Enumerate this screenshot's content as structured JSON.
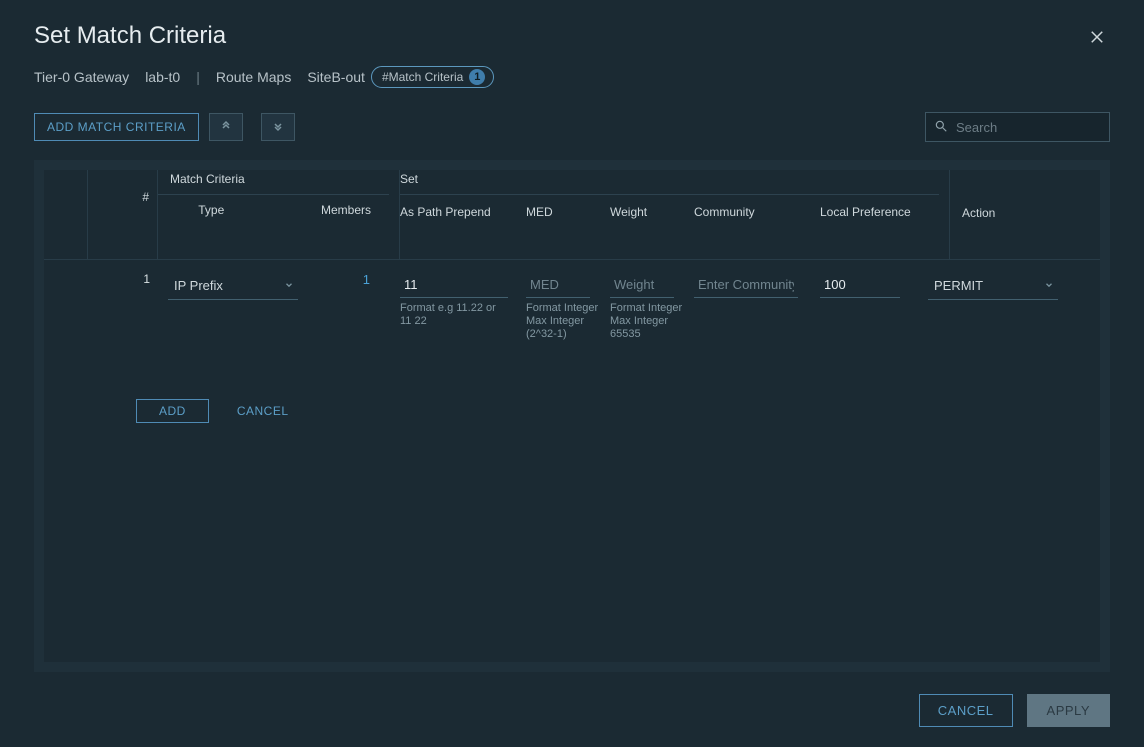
{
  "header": {
    "title": "Set Match Criteria"
  },
  "breadcrumb": {
    "segment1": "Tier-0 Gateway",
    "segment2": "lab-t0",
    "segment3": "Route Maps",
    "segment4": "SiteB-out",
    "chip_label": "#Match Criteria",
    "chip_count": "1"
  },
  "toolbar": {
    "add_button_label": "ADD MATCH CRITERIA",
    "search_placeholder": "Search"
  },
  "table": {
    "columns": {
      "index": "#",
      "match_criteria": "Match Criteria",
      "type": "Type",
      "members": "Members",
      "set": "Set",
      "as_path_prepend": "As Path Prepend",
      "med": "MED",
      "weight": "Weight",
      "community": "Community",
      "local_preference": "Local Preference",
      "action": "Action"
    },
    "row": {
      "index": "1",
      "type_selected": "IP Prefix",
      "members": "1",
      "as_path_prepend_value": "11",
      "as_path_prepend_hint": "Format e.g 11.22 or 11 22",
      "med_placeholder": "MED",
      "med_hint": "Format Integer Max Integer (2^32-1)",
      "weight_placeholder": "Weight",
      "weight_hint": "Format Integer Max Integer 65535",
      "community_placeholder": "Enter Community",
      "local_preference_value": "100",
      "action_selected": "PERMIT"
    }
  },
  "row_actions": {
    "add": "ADD",
    "cancel": "CANCEL"
  },
  "footer": {
    "cancel": "CANCEL",
    "apply": "APPLY"
  }
}
